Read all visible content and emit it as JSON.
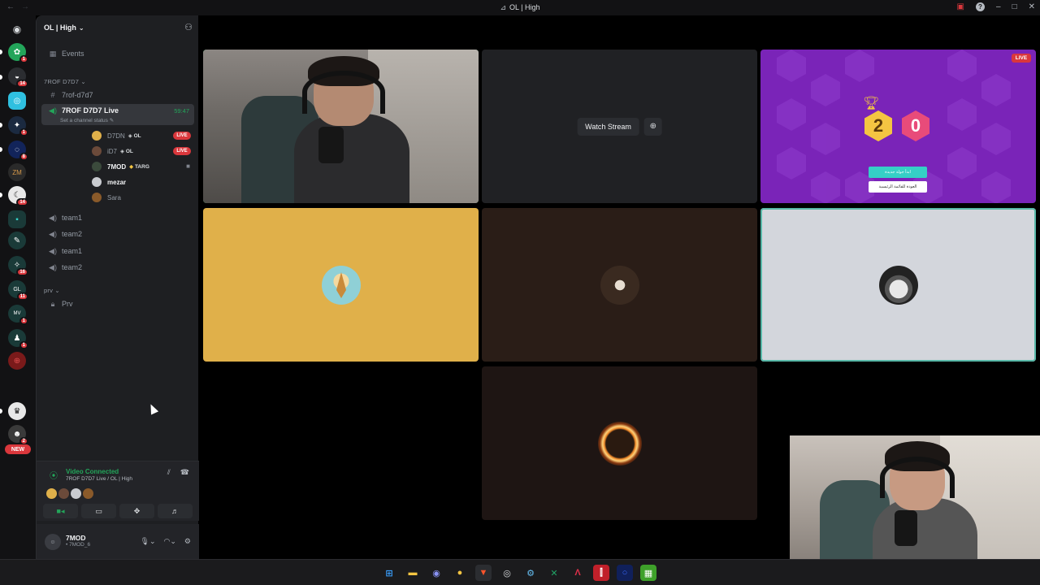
{
  "window": {
    "title": "OL | High"
  },
  "rail": {
    "badges": [
      "1",
      "14",
      "1",
      "8",
      "14",
      "16",
      "11",
      "1",
      "1",
      "2"
    ],
    "new_label": "NEW"
  },
  "guild": {
    "name": "OL | High",
    "events_label": "Events",
    "categories": [
      {
        "label": "7ROF D7D7"
      },
      {
        "label": "prv"
      }
    ],
    "text_channel": "7rof-d7d7",
    "active_channel": {
      "name": "7ROF D7D7 Live",
      "status": "Set a channel status",
      "timer": "59:47"
    },
    "voice_users": [
      {
        "name": "D7DN",
        "tag": "OL",
        "live": "LIVE",
        "color": "#e0b04a"
      },
      {
        "name": "iD7",
        "tag": "OL",
        "live": "LIVE",
        "color": "#6b4a3a"
      },
      {
        "name": "7MOD",
        "tag": "TARG",
        "live": "",
        "color": "#3b4a3c"
      },
      {
        "name": "mezar",
        "tag": "",
        "live": "",
        "color": "#c9cbd0"
      },
      {
        "name": "Sara",
        "tag": "",
        "live": "",
        "color": "#8a5a2a"
      }
    ],
    "voice_channels": [
      "team1",
      "team2",
      "team1",
      "team2"
    ],
    "private_channel": "Prv"
  },
  "voice_panel": {
    "status": "Video Connected",
    "channel": "7ROF D7D7 Live / OL | High"
  },
  "user_panel": {
    "name": "7MOD",
    "sub": "• 7MOD_6"
  },
  "stage": {
    "watch_stream_label": "Watch Stream",
    "live_label": "LIVE",
    "game": {
      "score_a": "2",
      "score_b": "0",
      "button_1": "ابدأ جولة جديدة",
      "button_2": "العودة للقائمة الرئيسية"
    }
  },
  "colors": {
    "accent_green": "#23a55a",
    "live_red": "#da373c",
    "game_purple": "#7a24b8",
    "tile_yellow": "#e0b04a",
    "tile_light": "#d3d6dc"
  }
}
